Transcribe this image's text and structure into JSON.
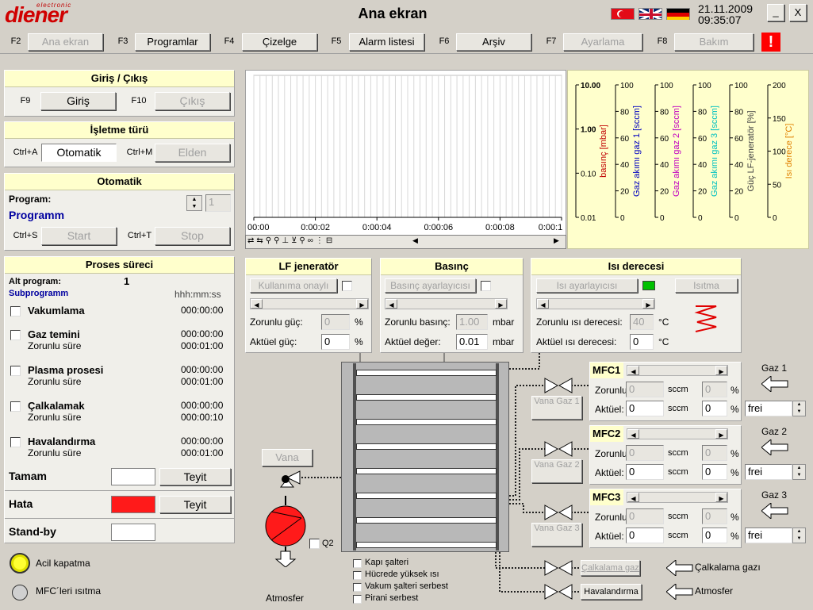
{
  "app": {
    "logo_small": "electronic",
    "logo": "diener",
    "title": "Ana ekran",
    "date": "21.11.2009",
    "time": "09:35:07"
  },
  "flags": [
    "flag-turkey-icon",
    "flag-uk-icon",
    "flag-germany-icon"
  ],
  "win": {
    "minimize": "_",
    "close": "X"
  },
  "fkeys": [
    {
      "key": "F2",
      "label": "Ana ekran",
      "enabled": false
    },
    {
      "key": "F3",
      "label": "Programlar",
      "enabled": true
    },
    {
      "key": "F4",
      "label": "Çizelge",
      "enabled": true
    },
    {
      "key": "F5",
      "label": "Alarm listesi",
      "enabled": true
    },
    {
      "key": "F6",
      "label": "Arşiv",
      "enabled": true
    },
    {
      "key": "F7",
      "label": "Ayarlama",
      "enabled": false
    },
    {
      "key": "F8",
      "label": "Bakım",
      "enabled": false
    }
  ],
  "alarm": "!",
  "io": {
    "title": "Giriş / Çıkış",
    "k1": "F9",
    "b1": "Giriş",
    "k2": "F10",
    "b2": "Çıkış"
  },
  "mode": {
    "title": "İşletme türü",
    "k1": "Ctrl+A",
    "b1": "Otomatik",
    "k2": "Ctrl+M",
    "b2": "Elden"
  },
  "auto": {
    "title": "Otomatik",
    "program_label": "Program:",
    "program_name": "Programm",
    "program_no": "1",
    "k1": "Ctrl+S",
    "b1": "Start",
    "k2": "Ctrl+T",
    "b2": "Stop"
  },
  "process": {
    "title": "Proses süreci",
    "alt_label": "Alt program:",
    "alt_value": "1",
    "sub": "Subprogramm",
    "fmt": "hhh:mm:ss",
    "steps": [
      {
        "name": "Vakumlama",
        "t1": "000:00:00",
        "sub": "",
        "t2": ""
      },
      {
        "name": "Gaz temini",
        "t1": "000:00:00",
        "sub": "Zorunlu süre",
        "t2": "000:01:00"
      },
      {
        "name": "Plasma prosesi",
        "t1": "000:00:00",
        "sub": "Zorunlu süre",
        "t2": "000:01:00"
      },
      {
        "name": "Çalkalamak",
        "t1": "000:00:00",
        "sub": "Zorunlu süre",
        "t2": "000:00:10"
      },
      {
        "name": "Havalandırma",
        "t1": "000:00:00",
        "sub": "Zorunlu süre",
        "t2": "000:01:00"
      }
    ],
    "done": "Tamam",
    "ack": "Teyit",
    "error": "Hata",
    "ack2": "Teyit",
    "standby": "Stand-by"
  },
  "estop": {
    "label": "Acil kapatma",
    "mfc_heat": "MFC´leri ısıtma"
  },
  "chart_data": {
    "type": "line",
    "x_ticks": [
      "00:00",
      "0:00:02",
      "0:00:04",
      "0:00:06",
      "0:00:08",
      "0:00:1"
    ],
    "series": [],
    "axes": [
      {
        "label": "basınç [mbar]",
        "color": "#c00000",
        "ticks": [
          "10.00",
          "1.00",
          "0.10",
          "0.01"
        ],
        "scale": "log"
      },
      {
        "label": "Gaz akımı gaz 1 [sccm]",
        "color": "#0000c0",
        "ticks": [
          "100",
          "80",
          "60",
          "40",
          "20",
          "0"
        ]
      },
      {
        "label": "Gaz akımı gaz 2 [sccm]",
        "color": "#c000c0",
        "ticks": [
          "100",
          "80",
          "60",
          "40",
          "20",
          "0"
        ]
      },
      {
        "label": "Gaz akımı gaz 3 [sccm]",
        "color": "#00c0c0",
        "ticks": [
          "100",
          "80",
          "60",
          "40",
          "20",
          "0"
        ]
      },
      {
        "label": "Güç LF-jeneratör [%]",
        "color": "#404040",
        "ticks": [
          "100",
          "80",
          "60",
          "40",
          "20",
          "0"
        ]
      },
      {
        "label": "Isı derece [°C]",
        "color": "#e08000",
        "ticks": [
          "200",
          "150",
          "100",
          "50",
          "0"
        ]
      }
    ]
  },
  "lf": {
    "title": "LF jeneratör",
    "btn": "Kullanıma onaylı",
    "set_label": "Zorunlu güç:",
    "set": "0",
    "unit": "%",
    "act_label": "Aktüel güç:",
    "act": "0",
    "unit2": "%"
  },
  "press": {
    "title": "Basınç",
    "btn": "Basınç ayarlayıcısı",
    "set_label": "Zorunlu basınç:",
    "set": "1.00",
    "unit": "mbar",
    "act_label": "Aktüel değer:",
    "act": "0.01",
    "unit2": "mbar"
  },
  "heat": {
    "title": "Isı derecesi",
    "btn": "Isı ayarlayıcısı",
    "btn2": "Isıtma",
    "set_label": "Zorunlu ısı derecesi:",
    "set": "40",
    "unit": "°C",
    "act_label": "Aktüel ısı derecesi:",
    "act": "0",
    "unit2": "°C"
  },
  "mfc": [
    {
      "name": "MFC1",
      "gas": "Gaz 1",
      "valve": "Vana Gaz 1",
      "set": "0",
      "set_pct": "0",
      "act": "0",
      "act_pct": "0",
      "mode": "frei"
    },
    {
      "name": "MFC2",
      "gas": "Gaz 2",
      "valve": "Vana Gaz 2",
      "set": "0",
      "set_pct": "0",
      "act": "0",
      "act_pct": "0",
      "mode": "frei"
    },
    {
      "name": "MFC3",
      "gas": "Gaz 3",
      "valve": "Vana Gaz 3",
      "set": "0",
      "set_pct": "0",
      "act": "0",
      "act_pct": "0",
      "mode": "frei"
    }
  ],
  "mfc_labels": {
    "set": "Zorunlu",
    "act": "Aktüel:",
    "sccm": "sccm",
    "pct": "%"
  },
  "bottom": {
    "vana": "Vana",
    "q2": "Q2",
    "atm": "Atmosfer",
    "flush_btn": "Çalkalama gazı",
    "flush": "Çalkalama gazı",
    "vent_btn": "Havalandırma",
    "vent": "Atmosfer",
    "checks": [
      "Kapı şalteri",
      "Hücrede yüksek ısı",
      "Vakum şalteri serbest",
      "Pirani serbest"
    ]
  }
}
